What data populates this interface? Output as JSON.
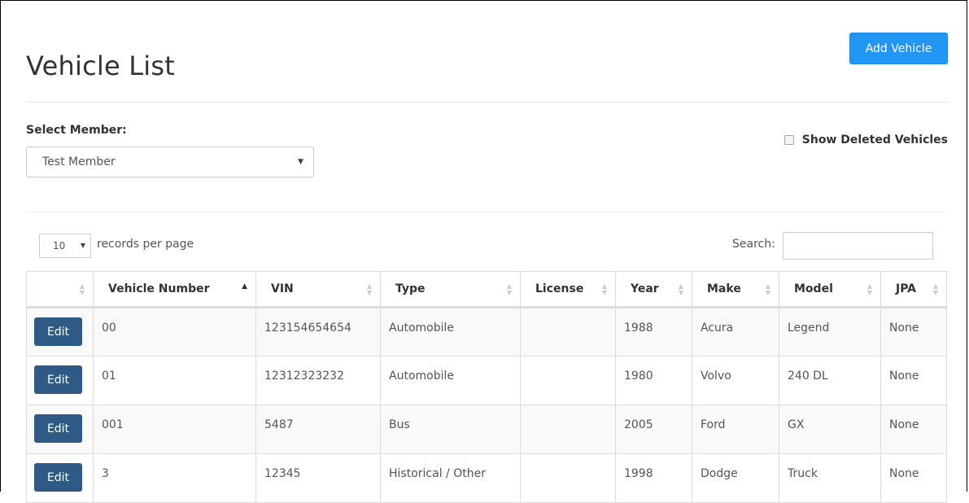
{
  "page": {
    "title": "Vehicle List",
    "add_button_label": "Add Vehicle"
  },
  "member": {
    "label": "Select Member:",
    "selected": "Test Member",
    "show_deleted_label": "Show Deleted Vehicles",
    "show_deleted_checked": false
  },
  "table_controls": {
    "page_length": "10",
    "page_length_label": "records per page",
    "search_label": "Search:",
    "search_value": ""
  },
  "columns": [
    "",
    "Vehicle Number",
    "VIN",
    "Type",
    "License",
    "Year",
    "Make",
    "Model",
    "JPA"
  ],
  "sorted_column": "Vehicle Number",
  "sort_direction": "ascending",
  "edit_label": "Edit",
  "rows": [
    {
      "vehicle_number": "00",
      "vin": "123154654654",
      "type": "Automobile",
      "license": "",
      "year": "1988",
      "make": "Acura",
      "model": "Legend",
      "jpa": "None"
    },
    {
      "vehicle_number": "01",
      "vin": "12312323232",
      "type": "Automobile",
      "license": "",
      "year": "1980",
      "make": "Volvo",
      "model": "240 DL",
      "jpa": "None"
    },
    {
      "vehicle_number": "001",
      "vin": "5487",
      "type": "Bus",
      "license": "",
      "year": "2005",
      "make": "Ford",
      "model": "GX",
      "jpa": "None"
    },
    {
      "vehicle_number": "3",
      "vin": "12345",
      "type": "Historical / Other",
      "license": "",
      "year": "1998",
      "make": "Dodge",
      "model": "Truck",
      "jpa": "None"
    }
  ],
  "colors": {
    "primary": "#2196f3",
    "edit_button": "#2f5a85"
  }
}
